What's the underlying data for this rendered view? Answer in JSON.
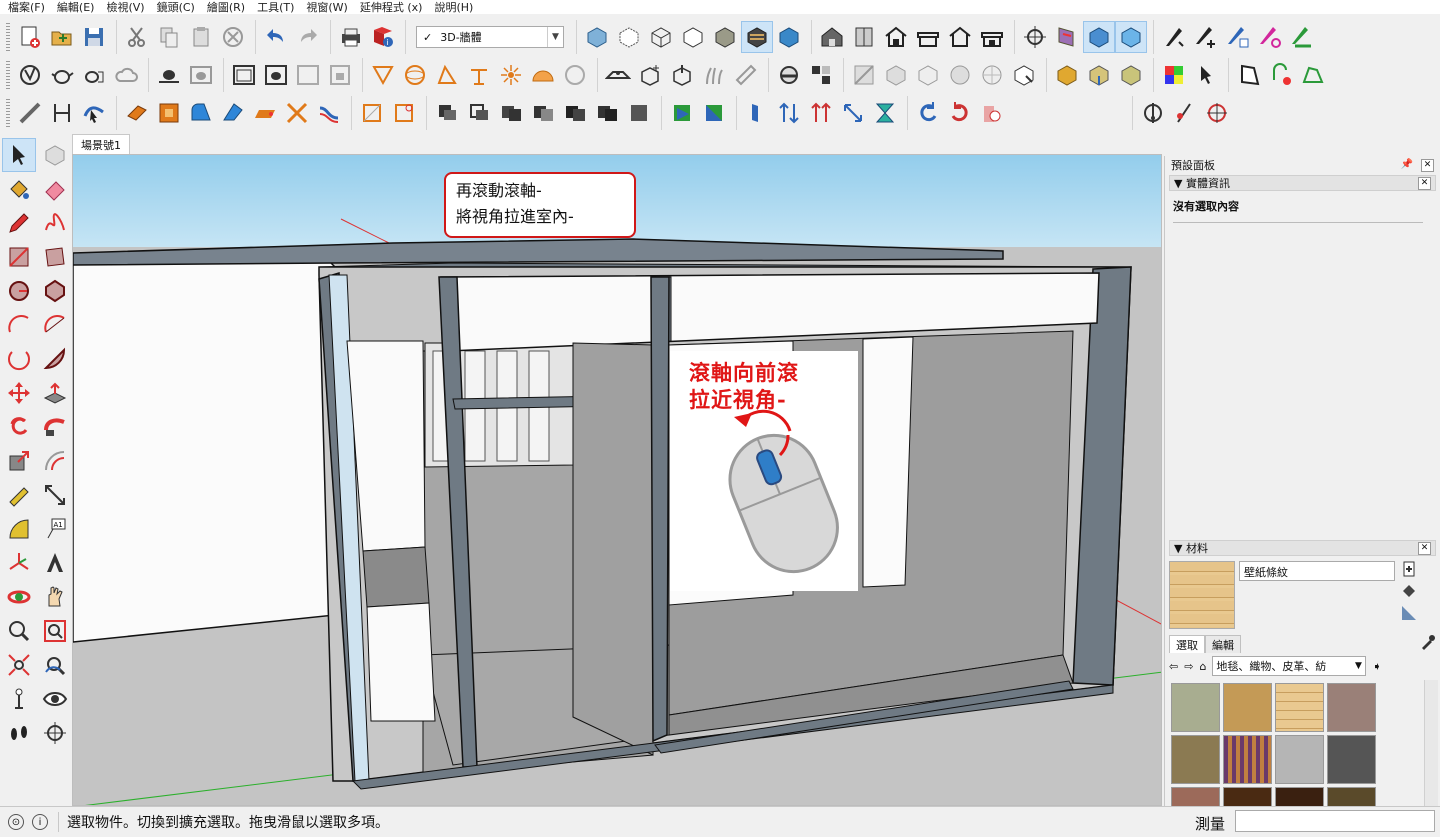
{
  "menu": [
    "檔案(F)",
    "編輯(E)",
    "檢視(V)",
    "鏡頭(C)",
    "繪圖(R)",
    "工具(T)",
    "視窗(W)",
    "延伸程式 (x)",
    "說明(H)"
  ],
  "toolbar": {
    "scene_select": {
      "check": "✓",
      "value": "3D-牆體"
    }
  },
  "scene_tabs": [
    "場景號1"
  ],
  "viewport": {
    "callout_lines": [
      "再滾動滾軸-",
      "將視角拉進室內-"
    ],
    "mouse_hint_lines": [
      "滾軸向前滾",
      "拉近視角-"
    ]
  },
  "right_panel": {
    "title": "預設面板",
    "pin_icon": "pin-icon",
    "entity_info": {
      "header": "實體資訊",
      "message": "沒有選取內容"
    },
    "materials": {
      "header": "材料",
      "material_name": "壁紙條紋",
      "tabs": [
        "選取",
        "編輯"
      ],
      "collection": "地毯、織物、皮革、紡"
    }
  },
  "status": {
    "message": "選取物件。切換到擴充選取。拖曳滑鼠以選取多項。",
    "measure_label": "測量"
  },
  "colors": {
    "sky": "#a9d6ee",
    "ground": "#bfbfbf",
    "wall_dark": "#6f7a84",
    "floor": "#a6a6a6",
    "callout_border": "#d01818",
    "hint_text": "#e01616"
  }
}
